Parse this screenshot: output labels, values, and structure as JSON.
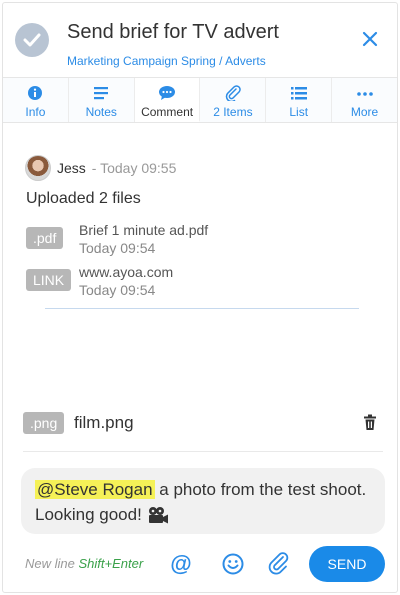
{
  "header": {
    "title": "Send brief for TV advert",
    "breadcrumb": "Marketing Campaign Spring / Adverts"
  },
  "tabs": [
    {
      "label": "Info",
      "icon": "info-icon"
    },
    {
      "label": "Notes",
      "icon": "notes-icon"
    },
    {
      "label": "Comment",
      "icon": "comment-icon",
      "active": true
    },
    {
      "label": "2 Items",
      "icon": "paperclip-icon"
    },
    {
      "label": "List",
      "icon": "list-icon"
    },
    {
      "label": "More",
      "icon": "more-icon"
    }
  ],
  "entry": {
    "author": "Jess",
    "meta": "- Today 09:55",
    "text": "Uploaded 2 files",
    "files": [
      {
        "badge": ".pdf",
        "name": "Brief 1 minute ad.pdf",
        "time": "Today 09:54"
      },
      {
        "badge": "LINK",
        "name": "www.ayoa.com",
        "time": "Today 09:54"
      }
    ]
  },
  "attachment": {
    "badge": ".png",
    "name": "film.png"
  },
  "composer": {
    "mention": "@Steve Rogan",
    "text": " a photo from the test shoot. Looking good! "
  },
  "footer": {
    "hint_prefix": "New line ",
    "hint_keys": "Shift+Enter",
    "at_symbol": "@",
    "send_label": "SEND"
  },
  "colors": {
    "accent": "#1a8ae8",
    "link": "#2c8ce6",
    "mention_highlight": "#f5f157",
    "badge": "#b7b7b7"
  }
}
